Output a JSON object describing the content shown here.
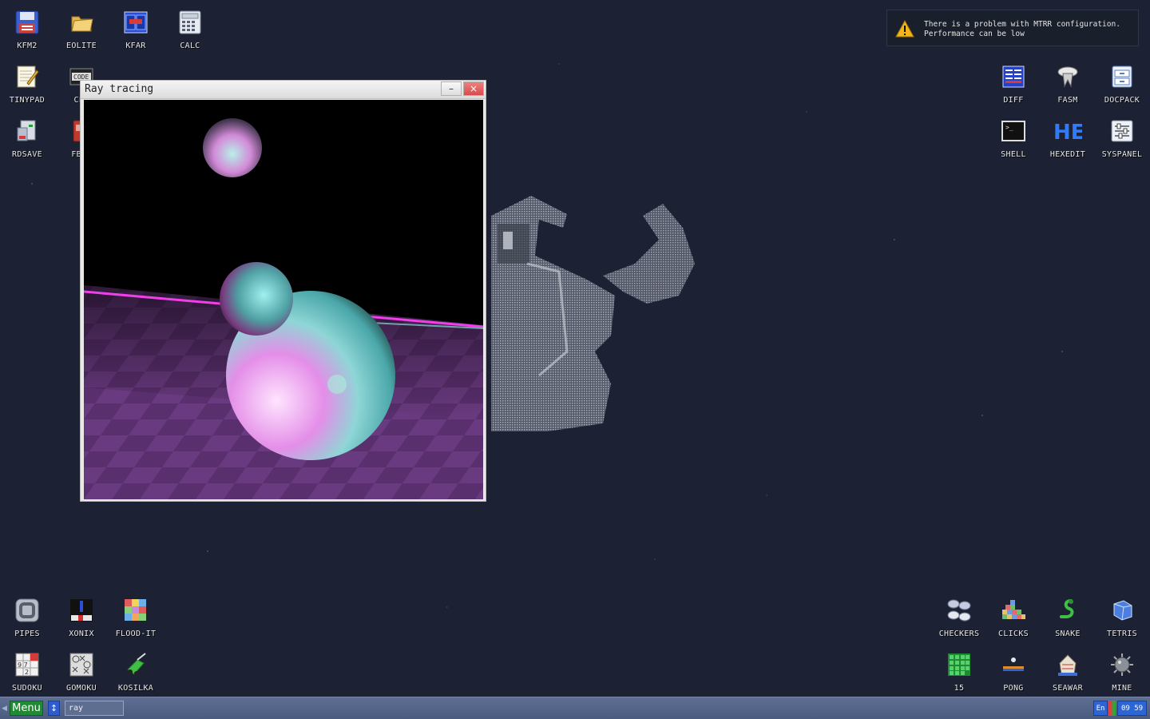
{
  "desktop": {
    "icons_left": [
      {
        "label": "KFM2",
        "icon": "floppy-disk-icon"
      },
      {
        "label": "EOLITE",
        "icon": "folder-icon"
      },
      {
        "label": "KFAR",
        "icon": "file-manager-icon"
      },
      {
        "label": "CALC",
        "icon": "calculator-icon"
      },
      {
        "label": "TINYPAD",
        "icon": "notepad-icon"
      },
      {
        "label": "CEI",
        "icon": "code-editor-icon"
      },
      {
        "label": "RDSAVE",
        "icon": "ramdisk-save-icon"
      },
      {
        "label": "FB2I",
        "icon": "book-icon"
      }
    ],
    "icons_right": [
      {
        "label": "DIFF",
        "icon": "diff-icon"
      },
      {
        "label": "FASM",
        "icon": "fasm-icon"
      },
      {
        "label": "DOCPACK",
        "icon": "docpack-icon"
      },
      {
        "label": "SHELL",
        "icon": "terminal-icon"
      },
      {
        "label": "HEXEDIT",
        "icon": "hex-editor-icon"
      },
      {
        "label": "SYSPANEL",
        "icon": "system-panel-icon"
      }
    ],
    "games_left": [
      {
        "label": "PIPES",
        "icon": "pipes-icon"
      },
      {
        "label": "XONIX",
        "icon": "xonix-icon"
      },
      {
        "label": "FLOOD-IT",
        "icon": "flood-it-icon"
      },
      {
        "label": "SUDOKU",
        "icon": "sudoku-icon"
      },
      {
        "label": "GOMOKU",
        "icon": "gomoku-icon"
      },
      {
        "label": "KOSILKA",
        "icon": "lawnmower-icon"
      }
    ],
    "games_right": [
      {
        "label": "CHECKERS",
        "icon": "checkers-icon"
      },
      {
        "label": "CLICKS",
        "icon": "clicks-icon"
      },
      {
        "label": "SNAKE",
        "icon": "snake-icon"
      },
      {
        "label": "TETRIS",
        "icon": "tetris-icon"
      },
      {
        "label": "15",
        "icon": "fifteen-puzzle-icon"
      },
      {
        "label": "PONG",
        "icon": "pong-icon"
      },
      {
        "label": "SEAWAR",
        "icon": "seawar-icon"
      },
      {
        "label": "MINE",
        "icon": "mine-icon"
      }
    ]
  },
  "notification": {
    "icon": "warning-icon",
    "line1": "There is a problem with MTRR configuration.",
    "line2": "Performance can be low"
  },
  "window": {
    "title": "Ray tracing",
    "minimize_symbol": "–",
    "close_symbol": "×"
  },
  "taskbar": {
    "menu_label": "Menu",
    "switch_symbol": "↕",
    "task_label": "ray",
    "language": "En",
    "clock": "09 59"
  },
  "colors": {
    "desktop_bg": "#1c2233",
    "menu_green": "#1f8a33",
    "close_red": "#d84b4b",
    "tray_blue": "#2c66d6"
  }
}
